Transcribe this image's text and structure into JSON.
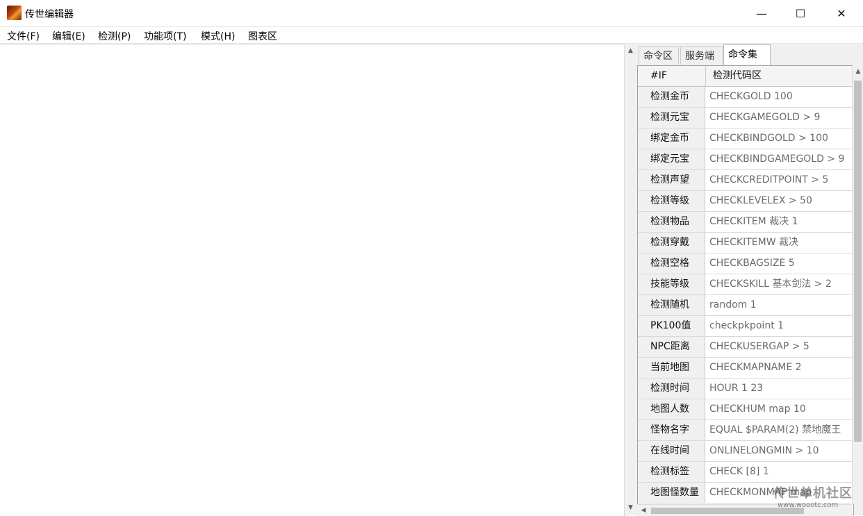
{
  "window": {
    "title": "传世编辑器",
    "minimize_glyph": "—",
    "maximize_glyph": "☐",
    "close_glyph": "✕",
    "icon": "app-flame-icon"
  },
  "menu": [
    "文件(F)",
    "编辑(E)",
    "检测(P)",
    "功能项(T)",
    "模式(H)",
    "图表区"
  ],
  "tabs": [
    "命令区",
    "服务端",
    "命令集"
  ],
  "grid": {
    "header": [
      "#IF",
      "检测代码区"
    ],
    "rows": [
      {
        "label": "检测金币",
        "value": "CHECKGOLD 100"
      },
      {
        "label": "检测元宝",
        "value": "CHECKGAMEGOLD > 9"
      },
      {
        "label": "绑定金币",
        "value": "CHECKBINDGOLD > 100"
      },
      {
        "label": "绑定元宝",
        "value": "CHECKBINDGAMEGOLD > 9"
      },
      {
        "label": "检测声望",
        "value": "CHECKCREDITPOINT > 5"
      },
      {
        "label": "检测等级",
        "value": "CHECKLEVELEX > 50"
      },
      {
        "label": "检测物品",
        "value": "CHECKITEM 裁决 1"
      },
      {
        "label": "检测穿戴",
        "value": "CHECKITEMW 裁决"
      },
      {
        "label": "检测空格",
        "value": "CHECKBAGSIZE 5"
      },
      {
        "label": "技能等级",
        "value": "CHECKSKILL 基本剑法 > 2"
      },
      {
        "label": "检测随机",
        "value": "random 1"
      },
      {
        "label": "PK100值",
        "value": "checkpkpoint 1"
      },
      {
        "label": "NPC距离",
        "value": "CHECKUSERGAP > 5"
      },
      {
        "label": "当前地图",
        "value": "CHECKMAPNAME 2"
      },
      {
        "label": "检测时间",
        "value": "HOUR 1 23"
      },
      {
        "label": "地图人数",
        "value": "CHECKHUM map 10"
      },
      {
        "label": "怪物名字",
        "value": "EQUAL $PARAM(2) 禁地魔王"
      },
      {
        "label": "在线时间",
        "value": "ONLINELONGMIN > 10"
      },
      {
        "label": "检测标签",
        "value": "CHECK [8] 1"
      },
      {
        "label": "地图怪数量",
        "value": "CHECKMONMAP map"
      }
    ]
  },
  "watermark": {
    "text": "传世单机社区",
    "url": "www.woootc.com"
  }
}
